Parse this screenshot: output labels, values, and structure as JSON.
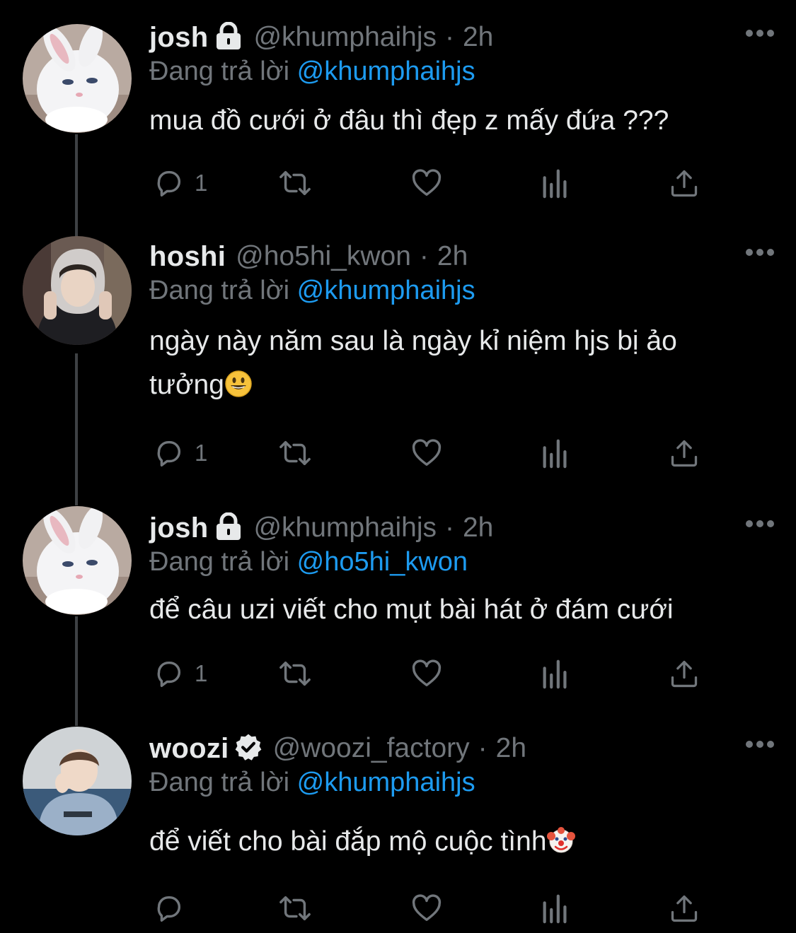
{
  "tweets": [
    {
      "name": "josh",
      "badge": "lock-icon",
      "handle": "@khumphaihjs",
      "time": "2h",
      "reply_prefix": "Đang trả lời",
      "reply_to": "@khumphaihjs",
      "text": "mua đồ cưới ở đâu thì đẹp z mấy đứa ???",
      "reply_count": "1",
      "avatar": "white-rabbit-avatar"
    },
    {
      "name": "hoshi",
      "badge": "",
      "handle": "@ho5hi_kwon",
      "time": "2h",
      "reply_prefix": "Đang trả lời",
      "reply_to": "@khumphaihjs",
      "text": "ngày này năm sau là ngày kỉ niệm hjs bị ảo tưởng",
      "text_emoji": "grinning-face-emoji",
      "reply_count": "1",
      "avatar": "person-hoodie-avatar"
    },
    {
      "name": "josh",
      "badge": "lock-icon",
      "handle": "@khumphaihjs",
      "time": "2h",
      "reply_prefix": "Đang trả lời",
      "reply_to": "@ho5hi_kwon",
      "text": "để câu uzi viết cho mụt bài hát ở đám cưới",
      "reply_count": "1",
      "avatar": "white-rabbit-avatar"
    },
    {
      "name": "woozi",
      "badge": "verified-icon",
      "handle": "@woozi_factory",
      "time": "2h",
      "reply_prefix": "Đang trả lời",
      "reply_to": "@khumphaihjs",
      "text": "để viết cho bài đắp mộ cuộc tình",
      "text_emoji": "clown-face-emoji",
      "reply_count": "",
      "avatar": "person-sweater-avatar"
    }
  ],
  "colors": {
    "background": "#000000",
    "text": "#e7e9ea",
    "secondary": "#71767b",
    "link": "#1d9bf0",
    "thread_line": "#3e4144"
  }
}
